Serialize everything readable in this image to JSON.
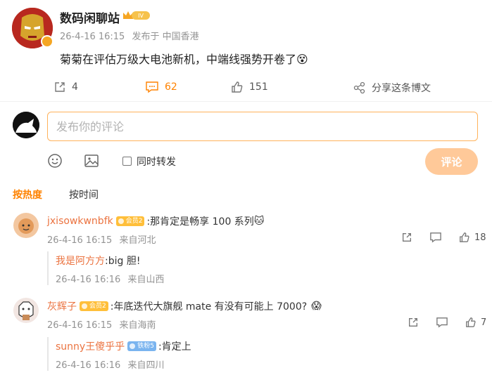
{
  "post": {
    "author": "数码闲聊站",
    "level_badge": "IV",
    "time": "26-4-16 16:15",
    "source": "发布于 中国香港",
    "text": "菊菊在评估万级大电池新机，中端线强势开卷了",
    "emoji": "😵",
    "actions": {
      "repost_count": "4",
      "comment_count": "62",
      "like_count": "151",
      "share_label": "分享这条博文"
    }
  },
  "composer": {
    "placeholder": "发布你的评论",
    "repost_label": "同时转发",
    "submit_label": "评论"
  },
  "sort_tabs": [
    "按热度",
    "按时间"
  ],
  "comments": [
    {
      "name": "jxisowkwnbfk",
      "badge": "会员2",
      "text": ":那肯定是畅享 100 系列",
      "emoji": "🐱",
      "time": "26-4-16 16:15",
      "location": "来自河北",
      "likes": "18",
      "reply": {
        "name": "我是阿方方",
        "text": ":big 胆!",
        "time": "26-4-16 16:16",
        "location": "来自山西"
      }
    },
    {
      "name": "灰辉子",
      "badge": "会员2",
      "text": ":年底迭代大旗舰 mate 有没有可能上 7000?",
      "emoji": "😱",
      "time": "26-4-16 16:15",
      "location": "来自海南",
      "likes": "7",
      "reply": {
        "name": "sunny王傻乎乎",
        "badge": "铁粉5",
        "text": ":肯定上",
        "time": "26-4-16 16:16",
        "location": "来自四川"
      }
    }
  ],
  "colors": {
    "accent": "#ff8200",
    "name": "#eb7340",
    "meta": "#939393"
  }
}
